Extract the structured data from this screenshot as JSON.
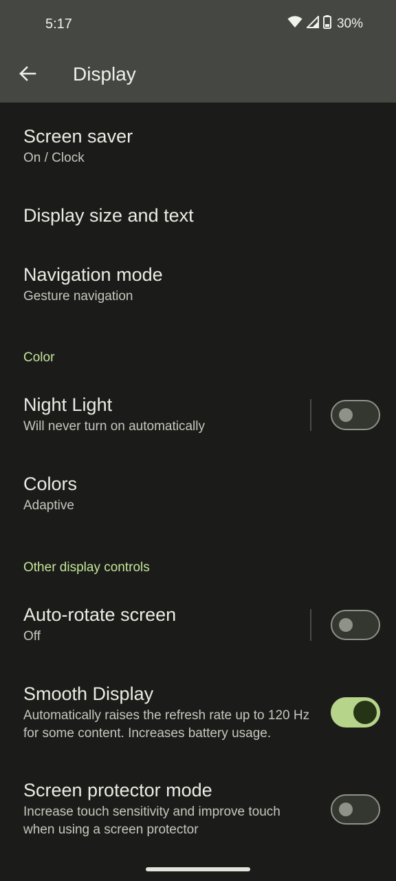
{
  "status_bar": {
    "time": "5:17",
    "battery_percent": "30%",
    "icons": [
      "wifi-icon",
      "signal-icon",
      "battery-icon"
    ]
  },
  "header": {
    "title": "Display",
    "back_icon": "arrow-back-icon"
  },
  "items": [
    {
      "title": "Screen saver",
      "subtitle": "On / Clock"
    },
    {
      "title": "Display size and text"
    },
    {
      "title": "Navigation mode",
      "subtitle": "Gesture navigation"
    },
    {
      "title": "Night Light",
      "subtitle": "Will never turn on automatically",
      "toggle": false
    },
    {
      "title": "Colors",
      "subtitle": "Adaptive"
    },
    {
      "title": "Auto-rotate screen",
      "subtitle": "Off",
      "toggle": false
    },
    {
      "title": "Smooth Display",
      "subtitle": "Automatically raises the refresh rate up to 120 Hz for some content. Increases battery usage.",
      "toggle": true
    },
    {
      "title": "Screen protector mode",
      "subtitle": "Increase touch sensitivity and improve touch when using a screen protector",
      "toggle": false
    }
  ],
  "sections": {
    "color": "Color",
    "other": "Other display controls"
  },
  "colors": {
    "header_bg": "#454842",
    "page_bg": "#1b1c19",
    "section_accent": "#c5e69a",
    "switch_on": "#b6d48a"
  }
}
